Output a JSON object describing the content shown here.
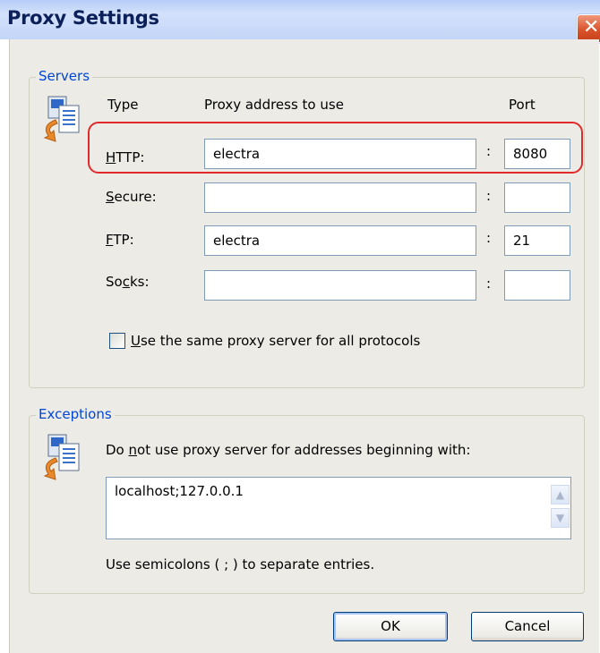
{
  "window": {
    "title": "Proxy Settings",
    "close_glyph": "✕"
  },
  "servers": {
    "legend": "Servers",
    "icon": "proxy-server-icon",
    "headers": {
      "type": "Type",
      "address": "Proxy address to use",
      "port": "Port"
    },
    "rows": [
      {
        "key": "http",
        "label_pre": "",
        "mnemonic": "H",
        "label_post": "TTP:",
        "address": "electra",
        "port": "8080",
        "highlighted": true
      },
      {
        "key": "secure",
        "label_pre": "",
        "mnemonic": "S",
        "label_post": "ecure:",
        "address": "",
        "port": ""
      },
      {
        "key": "ftp",
        "label_pre": "",
        "mnemonic": "F",
        "label_post": "TP:",
        "address": "electra",
        "port": "21"
      },
      {
        "key": "socks",
        "label_pre": "So",
        "mnemonic": "c",
        "label_post": "ks:",
        "address": "",
        "port": ""
      }
    ],
    "colon": ":",
    "same_proxy": {
      "mnemonic": "U",
      "label_post": "se the same proxy server for all protocols",
      "checked": false
    }
  },
  "exceptions": {
    "legend": "Exceptions",
    "icon": "proxy-exceptions-icon",
    "description_pre": "Do ",
    "description_mnemonic": "n",
    "description_post": "ot use proxy server for addresses beginning with:",
    "value": "localhost;127.0.0.1",
    "hint": "Use semicolons ( ; ) to separate entries."
  },
  "buttons": {
    "ok": "OK",
    "cancel": "Cancel"
  },
  "colors": {
    "highlight": "#e12b2b",
    "legend": "#0046d5",
    "title": "#0b1f58"
  }
}
